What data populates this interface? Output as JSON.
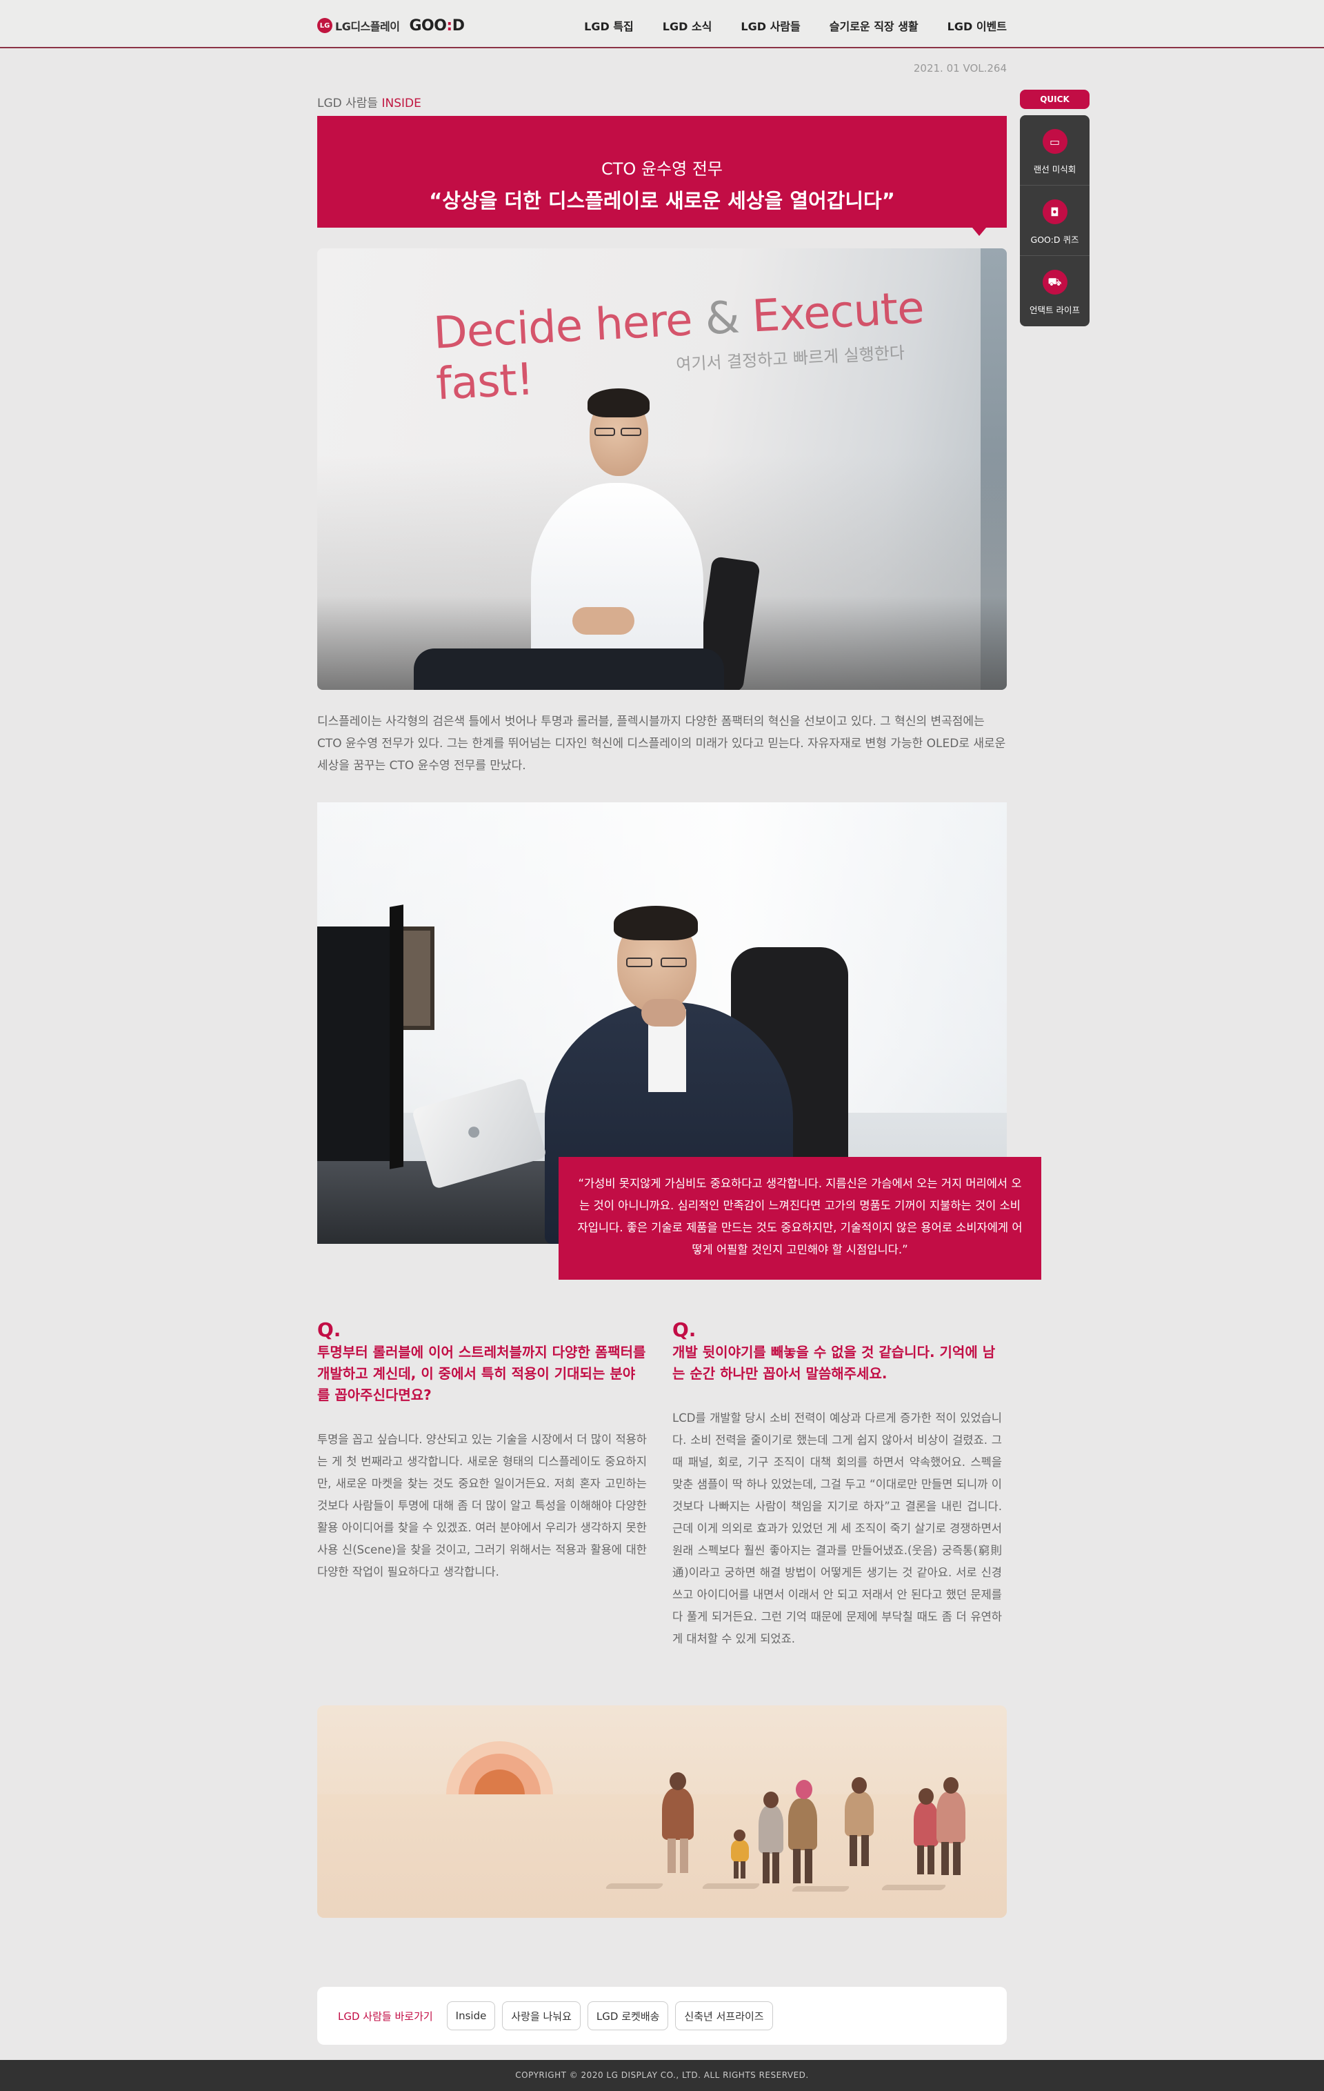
{
  "header": {
    "logo_mark": "LG",
    "logo_text": "LG디스플레이",
    "good_left": "GOO",
    "good_colon": ":",
    "good_right": "D",
    "nav": [
      "LGD 특집",
      "LGD 소식",
      "LGD 사람들",
      "슬기로운 직장 생활",
      "LGD 이벤트"
    ]
  },
  "issue": "2021. 01 VOL.264",
  "section": {
    "label": "LGD 사람들 ",
    "accent": "INSIDE"
  },
  "banner": {
    "subtitle": "CTO 윤수영 전무",
    "title": "“상상을 더한 디스플레이로 새로운 세상을 열어갑니다”"
  },
  "photo1": {
    "slogan_a": "Decide here ",
    "slogan_amp": "&",
    "slogan_b": " Execute fast!",
    "slogan_sub": "여기서 결정하고 빠르게 실행한다"
  },
  "intro": "디스플레이는 사각형의 검은색 틀에서 벗어나 투명과 롤러블, 플렉시블까지 다양한 폼팩터의 혁신을 선보이고 있다. 그 혁신의 변곡점에는 CTO 윤수영 전무가 있다. 그는 한계를 뛰어넘는 디자인 혁신에 디스플레이의 미래가 있다고 믿는다. 자유자재로 변형 가능한 OLED로 새로운 세상을 꿈꾸는 CTO 윤수영 전무를 만났다.",
  "quote": "“가성비 못지않게 가심비도 중요하다고 생각합니다. 지름신은 가슴에서 오는 거지 머리에서 오는 것이 아니니까요. 심리적인 만족감이 느껴진다면 고가의 명품도 기꺼이 지불하는 것이 소비자입니다. 좋은 기술로 제품을 만드는 것도 중요하지만, 기술적이지 않은 용어로 소비자에게 어떻게 어필할 것인지 고민해야 할 시점입니다.”",
  "qa": [
    {
      "q": "Q.",
      "question": "투명부터 롤러블에 이어 스트레처블까지 다양한 폼팩터를 개발하고 계신데, 이 중에서 특히 적용이 기대되는 분야를 꼽아주신다면요?",
      "answer": "투명을 꼽고 싶습니다. 양산되고 있는 기술을 시장에서 더 많이 적용하는 게 첫 번째라고 생각합니다. 새로운 형태의 디스플레이도 중요하지만, 새로운 마켓을 찾는 것도 중요한 일이거든요. 저희 혼자 고민하는 것보다 사람들이 투명에 대해 좀 더 많이 알고 특성을 이해해야 다양한 활용 아이디어를 찾을 수 있겠죠. 여러 분야에서 우리가 생각하지 못한 사용 신(Scene)을 찾을 것이고, 그러기 위해서는 적용과 활용에 대한 다양한 작업이 필요하다고 생각합니다."
    },
    {
      "q": "Q.",
      "question": "개발 뒷이야기를 빼놓을 수 없을 것 같습니다. 기억에 남는 순간 하나만 꼽아서 말씀해주세요.",
      "answer": "LCD를 개발할 당시 소비 전력이 예상과 다르게 증가한 적이 있었습니다. 소비 전력을 줄이기로 했는데 그게 쉽지 않아서 비상이 걸렸죠. 그때 패널, 회로, 기구 조직이 대책 회의를 하면서 약속했어요. 스펙을 맞춘 샘플이 딱 하나 있었는데, 그걸 두고 “이대로만 만들면 되니까 이것보다 나빠지는 사람이 책임을 지기로 하자”고 결론을 내린 겁니다. 근데 이게 의외로 효과가 있었던 게 세 조직이 죽기 살기로 경쟁하면서 원래 스펙보다 훨씬 좋아지는 결과를 만들어냈죠.(웃음) 궁즉통(窮則通)이라고 궁하면 해결 방법이 어떻게든 생기는 것 같아요. 서로 신경 쓰고 아이디어를 내면서 이래서 안 되고 저래서 안 된다고 했던 문제를 다 풀게 되거든요. 그런 기억 때문에 문제에 부닥칠 때도 좀 더 유연하게 대처할 수 있게 되었죠."
    }
  ],
  "quick": {
    "title": "QUICK",
    "items": [
      {
        "label": "랜선 미식회",
        "icon": "tv-icon",
        "glyph": "▭"
      },
      {
        "label": "GOO:D 퀴즈",
        "icon": "bag-icon",
        "glyph": "◘"
      },
      {
        "label": "언택트 라이프",
        "icon": "cart-icon",
        "glyph": "⛟"
      }
    ]
  },
  "shortcuts": {
    "label": "LGD 사람들 바로가기",
    "buttons": [
      "Inside",
      "사랑을 나눠요",
      "LGD 로켓배송",
      "신축년 서프라이즈"
    ]
  },
  "footer": "COPYRIGHT © 2020 LG DISPLAY CO., LTD. ALL RIGHTS RESERVED.",
  "colors": {
    "accent": "#c20d45",
    "background": "#e9e8e8",
    "footer": "#323232"
  }
}
